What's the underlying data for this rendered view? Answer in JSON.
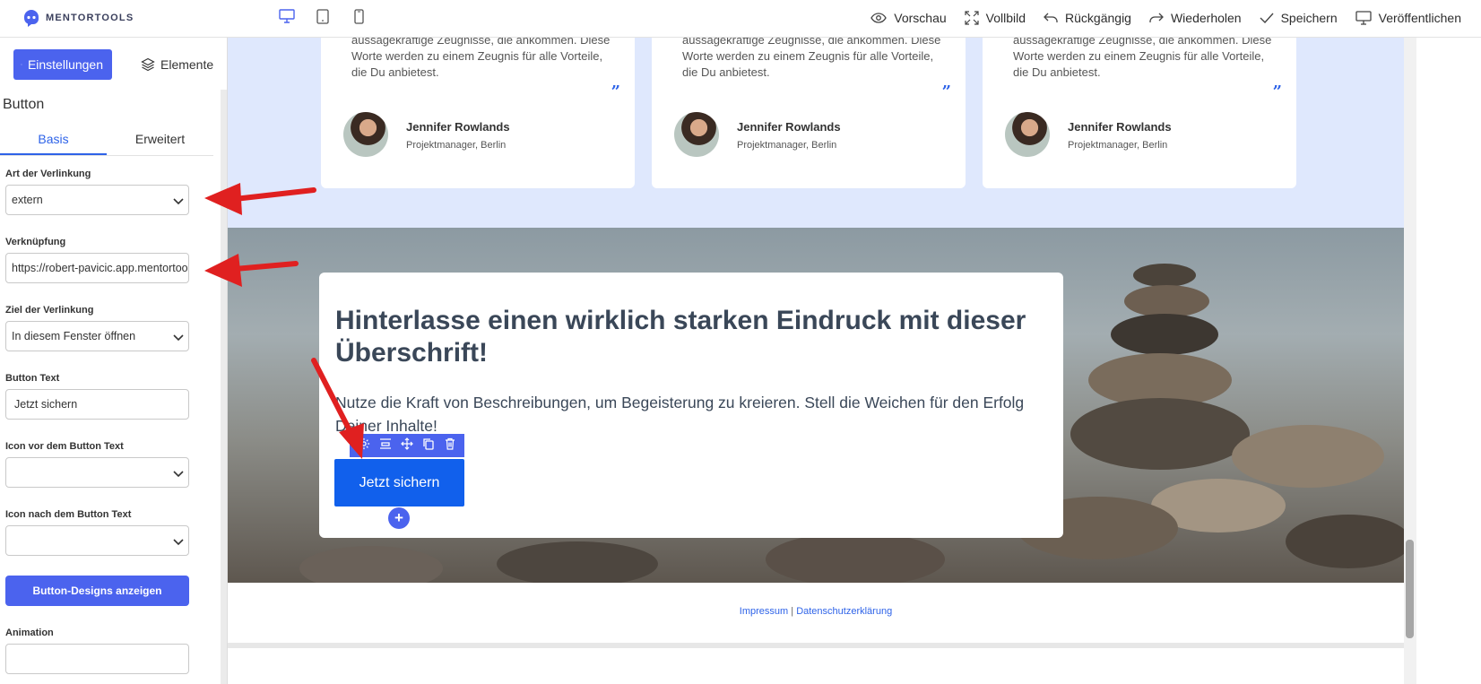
{
  "brand": {
    "name": "MENTORTOOLS",
    "accent": "#4b63ee"
  },
  "devices": [
    {
      "icon": "desktop-icon",
      "active": true
    },
    {
      "icon": "tablet-icon",
      "active": false
    },
    {
      "icon": "mobile-icon",
      "active": false
    }
  ],
  "toolbar": {
    "preview": "Vorschau",
    "fullscreen": "Vollbild",
    "undo": "Rückgängig",
    "redo": "Wiederholen",
    "save": "Speichern",
    "publish": "Veröffentlichen"
  },
  "sidebar": {
    "tab_settings": "Einstellungen",
    "tab_elements": "Elemente",
    "heading": "Button",
    "subtab_basic": "Basis",
    "subtab_advanced": "Erweitert",
    "fields": {
      "link_type_label": "Art der Verlinkung",
      "link_type_value": "extern",
      "link_label": "Verknüpfung",
      "link_value": "https://robert-pavicic.app.mentortools",
      "target_label": "Ziel der Verlinkung",
      "target_value": "In diesem Fenster öffnen",
      "button_text_label": "Button Text",
      "button_text_value": "Jetzt sichern",
      "icon_before_label": "Icon vor dem Button Text",
      "icon_before_value": "",
      "icon_after_label": "Icon nach dem Button Text",
      "icon_after_value": "",
      "designs_button": "Button-Designs anzeigen",
      "animation_label": "Animation"
    }
  },
  "testimonials": [
    {
      "quote": "aussagekräftige Zeugnisse, die ankommen. Diese Worte werden zu einem Zeugnis für alle Vorteile, die Du anbietest.",
      "name": "Jennifer Rowlands",
      "role": "Projektmanager, Berlin",
      "mark": "”"
    },
    {
      "quote": "aussagekräftige Zeugnisse, die ankommen. Diese Worte werden zu einem Zeugnis für alle Vorteile, die Du anbietest.",
      "name": "Jennifer Rowlands",
      "role": "Projektmanager, Berlin",
      "mark": "”"
    },
    {
      "quote": "aussagekräftige Zeugnisse, die ankommen. Diese Worte werden zu einem Zeugnis für alle Vorteile, die Du anbietest.",
      "name": "Jennifer Rowlands",
      "role": "Projektmanager, Berlin",
      "mark": "”"
    }
  ],
  "hero": {
    "title": "Hinterlasse einen wirklich starken Eindruck mit dieser Überschrift!",
    "text": "Nutze die Kraft von Beschreibungen, um Begeisterung zu kreieren. Stell die Weichen für den Erfolg Deiner Inhalte!",
    "button": "Jetzt sichern",
    "add": "+"
  },
  "footer": {
    "imprint": "Impressum",
    "separator": " | ",
    "privacy": "Datenschutzerklärung"
  }
}
